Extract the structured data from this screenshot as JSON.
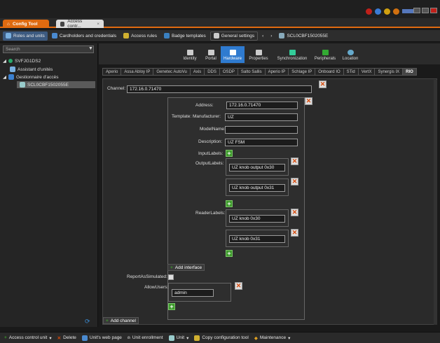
{
  "tabs": {
    "config_tool": "Config Tool",
    "access_control": "Access contr..."
  },
  "toolbar": {
    "roles_and_units": "Roles and units",
    "cardholders": "Cardholders and credentials",
    "access_rules": "Access rules",
    "badge_templates": "Badge templates",
    "general_settings": "General settings",
    "unit_path": "SCL0CBF1502055E"
  },
  "left": {
    "search_placeholder": "Search",
    "tree": [
      {
        "label": "SVFJG1DS2"
      },
      {
        "label": "Assistant d'unités"
      },
      {
        "label": "Gestionnaire d'accès"
      },
      {
        "label": "SCL0CBF1502055E"
      }
    ]
  },
  "categories": [
    {
      "label": "Identity"
    },
    {
      "label": "Portal"
    },
    {
      "label": "Hardware"
    },
    {
      "label": "Properties"
    },
    {
      "label": "Synchronization"
    },
    {
      "label": "Peripherals"
    },
    {
      "label": "Location"
    }
  ],
  "subtabs": [
    "Aperio",
    "Assa Abloy IP",
    "Genetec AutoVu",
    "Axis",
    "DDS",
    "OSDP",
    "Salto Sallis",
    "Aperio IP",
    "Schlage IP",
    "Onboard IO",
    "STid",
    "VertX",
    "Synergis IX",
    "RIO"
  ],
  "form": {
    "channel_label": "Channel:",
    "channel_value": "172.16.0.71470",
    "address_label": "Address:",
    "address_value": "172.16.0.71470",
    "template_label": "Template:",
    "manufacturer_label": "Manufacturer:",
    "manufacturer_value": "UZ",
    "modelname_label": "ModelName:",
    "modelname_value": "",
    "description_label": "Description:",
    "description_value": "UZ FSM",
    "inputlabels_label": "InputLabels:",
    "outputlabels_label": "OutputLabels:",
    "output_values": [
      "UZ knob output 0x30",
      "UZ knob output 0x31"
    ],
    "readerlabels_label": "ReaderLabels:",
    "reader_values": [
      "UZ knob 0x30",
      "UZ knob 0x31"
    ],
    "add_interface": "Add interface",
    "report_simulated_label": "ReportAsSimulated:",
    "allow_users_label": "AllowUsers:",
    "allow_users_value": "admin",
    "add_channel": "Add channel"
  },
  "bottombar": {
    "add_unit": "Access control unit",
    "delete": "Delete",
    "web_page": "Unit's web page",
    "enrollment": "Unit enrollment",
    "unit": "Unit",
    "copy_config": "Copy configuration tool",
    "maintenance": "Maintenance"
  }
}
